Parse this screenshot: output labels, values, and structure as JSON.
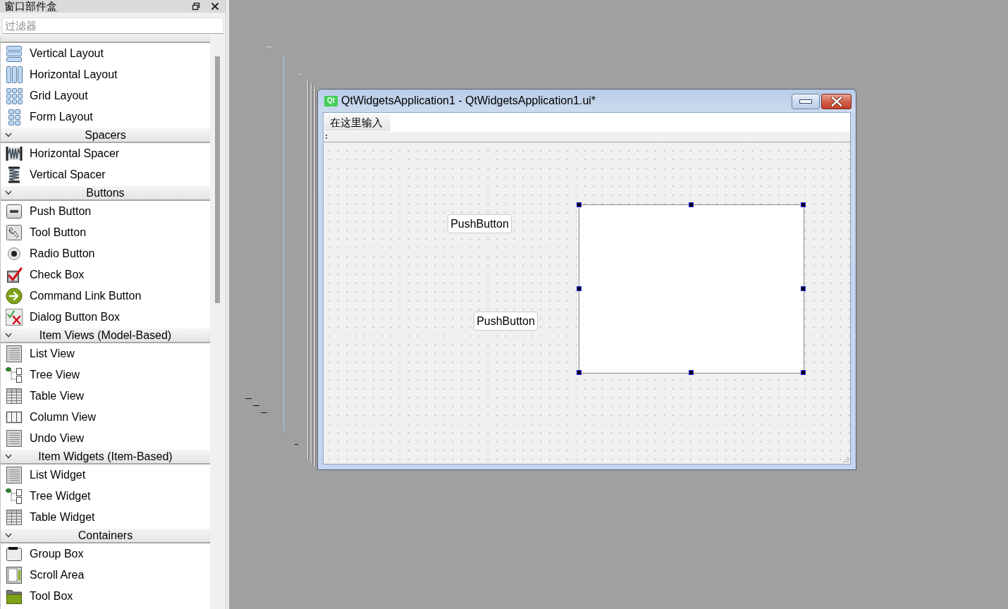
{
  "widget_box": {
    "title": "窗口部件盒",
    "filter": {
      "placeholder": "过滤器"
    },
    "categories": [
      {
        "items": [
          {
            "label": "Vertical Layout",
            "kind": "vlayout"
          },
          {
            "label": "Horizontal Layout",
            "kind": "hlayout"
          },
          {
            "label": "Grid Layout",
            "kind": "grid"
          },
          {
            "label": "Form Layout",
            "kind": "form"
          }
        ]
      },
      {
        "name": "Spacers",
        "expanded": true,
        "items": [
          {
            "label": "Horizontal Spacer",
            "kind": "hspacer"
          },
          {
            "label": "Vertical Spacer",
            "kind": "vspacer"
          }
        ]
      },
      {
        "name": "Buttons",
        "expanded": true,
        "items": [
          {
            "label": "Push Button",
            "kind": "push"
          },
          {
            "label": "Tool Button",
            "kind": "tool"
          },
          {
            "label": "Radio Button",
            "kind": "radio"
          },
          {
            "label": "Check Box",
            "kind": "check"
          },
          {
            "label": "Command Link Button",
            "kind": "link"
          },
          {
            "label": "Dialog Button Box",
            "kind": "buttonbox"
          }
        ]
      },
      {
        "name": "Item Views (Model-Based)",
        "expanded": true,
        "items": [
          {
            "label": "List View",
            "kind": "list"
          },
          {
            "label": "Tree View",
            "kind": "tree"
          },
          {
            "label": "Table View",
            "kind": "table"
          },
          {
            "label": "Column View",
            "kind": "columns"
          },
          {
            "label": "Undo View",
            "kind": "undo"
          }
        ]
      },
      {
        "name": "Item Widgets (Item-Based)",
        "expanded": true,
        "items": [
          {
            "label": "List Widget",
            "kind": "list"
          },
          {
            "label": "Tree Widget",
            "kind": "tree"
          },
          {
            "label": "Table Widget",
            "kind": "table"
          }
        ]
      },
      {
        "name": "Containers",
        "expanded": true,
        "items": [
          {
            "label": "Group Box",
            "kind": "groupbox"
          },
          {
            "label": "Scroll Area",
            "kind": "scrollarea"
          },
          {
            "label": "Tool Box",
            "kind": "toolbox"
          }
        ]
      }
    ]
  },
  "designer_window": {
    "app_icon": "Qt",
    "title": "QtWidgetsApplication1 - QtWidgetsApplication1.ui*",
    "menu_bar": {
      "entry": "在这里输入"
    },
    "form_widgets": [
      {
        "kind": "push_button",
        "text": "PushButton",
        "selected": false
      },
      {
        "kind": "push_button",
        "text": "PushButton",
        "selected": false
      },
      {
        "kind": "blank",
        "selected": true
      }
    ]
  }
}
